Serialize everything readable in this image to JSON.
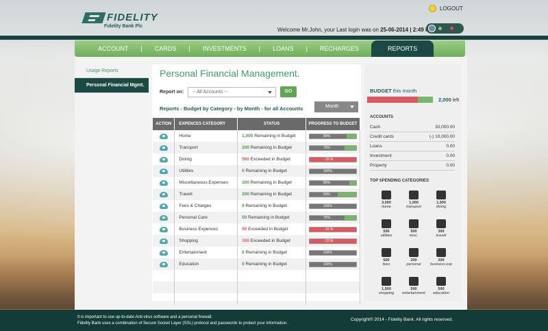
{
  "brand": {
    "name": "FIDELITY",
    "sub": "Fidelity Bank Plc"
  },
  "header": {
    "logout": "LOGOUT",
    "welcome_prefix": "Welcome Mr.John, your Last login was on ",
    "welcome_date": "25-06-2014 | 2:49 PM"
  },
  "nav": {
    "items": [
      "ACCOUNT",
      "CARDS",
      "INVESTMENTS",
      "LOANS",
      "RECHARGES",
      "REPORTS"
    ],
    "active": "REPORTS"
  },
  "sidebar": {
    "items": [
      "Usage Reports",
      "Personal Financial Mgmt."
    ]
  },
  "main": {
    "title": "Personal Financial Management.",
    "report_on": "Report on:",
    "account_select": "-- All Accounts --",
    "go": "GO",
    "subtitle": "Reports - Budget by Category - by Month - for all Accounts",
    "period": "Month"
  },
  "table": {
    "headers": [
      "ACTION",
      "EXPENCES CATEGORY",
      "STATUS",
      "PROGRESS TO BUDGET"
    ],
    "rows": [
      {
        "cat": "Home",
        "amt": "1,000",
        "status": "Remaining in Budget",
        "pct": "80%",
        "p": 80,
        "over": false
      },
      {
        "cat": "Transport",
        "amt": "200",
        "status": "Remaining in Budget",
        "pct": "75%",
        "p": 75,
        "over": false
      },
      {
        "cat": "Dining",
        "amt": "500",
        "status": "Exceeded in Budget",
        "pct": "- 20 %",
        "p": 100,
        "over": true
      },
      {
        "cat": "Utilities",
        "amt": "0",
        "status": "Remaining in Budget",
        "pct": "100%",
        "p": 100,
        "over": false
      },
      {
        "cat": "Miscellaneous Expenses",
        "amt": "100",
        "status": "Remaining in Budget",
        "pct": "85%",
        "p": 85,
        "over": false
      },
      {
        "cat": "Travell",
        "amt": "200",
        "status": "Remaining in Budget",
        "pct": "60%",
        "p": 60,
        "over": false
      },
      {
        "cat": "Fees & Charges",
        "amt": "0",
        "status": "Remaining in Budget",
        "pct": "100%",
        "p": 100,
        "over": false
      },
      {
        "cat": "Personal Care",
        "amt": "50",
        "status": "Remaining in Budget",
        "pct": "75%",
        "p": 75,
        "over": false
      },
      {
        "cat": "Business Expences",
        "amt": "50",
        "status": "Exceeded in Budget",
        "pct": "- 15 %",
        "p": 100,
        "over": true
      },
      {
        "cat": "Shopping",
        "amt": "100",
        "status": "Exceeded in Budget",
        "pct": "- 10 %",
        "p": 100,
        "over": true
      },
      {
        "cat": "Entertainment",
        "amt": "0",
        "status": "Remaining in Budget",
        "pct": "100%",
        "p": 100,
        "over": false
      },
      {
        "cat": "Education",
        "amt": "0",
        "status": "Remaining in Budget",
        "pct": "100%",
        "p": 100,
        "over": false
      }
    ]
  },
  "budget": {
    "label": "BUDGET",
    "label2": " this month",
    "left_amount": "2,000",
    "left_word": "left",
    "spent_fraction": 0.77
  },
  "accounts": {
    "heading": "ACCOUNTS",
    "rows": [
      [
        "Cash",
        "30,000.00"
      ],
      [
        "Credit cards",
        "(-) 10,000.00"
      ],
      [
        "Loans",
        "0.00"
      ],
      [
        "Investment",
        "0.00"
      ],
      [
        "Property",
        "0.00"
      ]
    ]
  },
  "top_spending": {
    "heading": "TOP SPENDING CATEGORIES",
    "items": [
      [
        "3,000",
        "home",
        "home-icon"
      ],
      [
        "1,000",
        "transport",
        "car-icon"
      ],
      [
        "1,500",
        "dining",
        "utensils-icon"
      ],
      [
        "500",
        "utilities",
        "bulb-icon"
      ],
      [
        "500",
        "misc.",
        "cabinet-icon"
      ],
      [
        "300",
        "travell",
        "plane-icon"
      ],
      [
        "500",
        "fees",
        "warning-icon"
      ],
      [
        "200",
        "personal",
        "bottle-icon"
      ],
      [
        "300",
        "business exp",
        "printer-icon"
      ],
      [
        "1,500",
        "shopping",
        "bag-icon"
      ],
      [
        "500",
        "entertainment",
        "money-icon"
      ],
      [
        "500",
        "education",
        "graduation-icon"
      ]
    ]
  },
  "footer": {
    "line1": "It is important to use up-to-date Anti-virus software and a personal firewall.",
    "line2": "Fidelity Bank uses a combination of Secure Socket Layer (SSL) protocol and passwords to protect your information.",
    "copyright": "Copyright© 2014 - Fidelity Bank. All rights reserved."
  },
  "colors": {
    "accent": "#1b4a43",
    "green": "#77b768",
    "red": "#db5a5f"
  }
}
